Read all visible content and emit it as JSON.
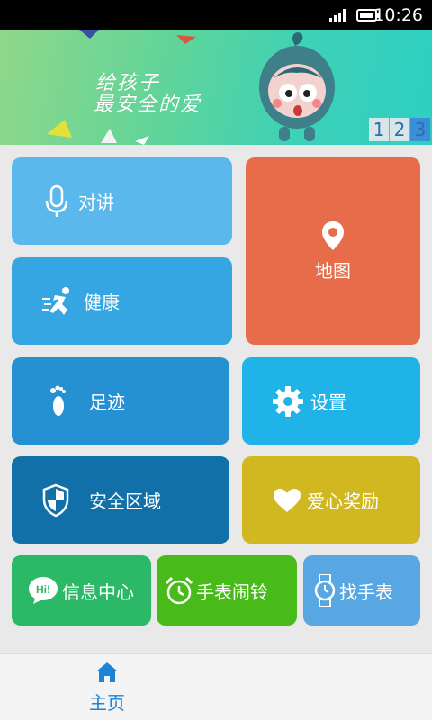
{
  "status_bar": {
    "time": "10:26"
  },
  "banner": {
    "slogan_line1": "给孩子",
    "slogan_line2": "最安全的爱",
    "pages": [
      "1",
      "2",
      "3"
    ],
    "active_page": "3"
  },
  "tiles": {
    "intercom": "对讲",
    "map": "地图",
    "health": "健康",
    "footprint": "足迹",
    "settings": "设置",
    "safe_zone": "安全区域",
    "love_reward": "爱心奖励",
    "message_center": "信息中心",
    "watch_alarm": "手表闹铃",
    "find_watch": "找手表"
  },
  "bottom_nav": {
    "home": "主页"
  },
  "colors": {
    "intercom": "#5bb8ec",
    "map": "#e76c49",
    "health": "#36a6e2",
    "footprint": "#2590d2",
    "settings": "#1fb3e8",
    "safe_zone": "#1270a8",
    "love_reward": "#d1b821",
    "message_center": "#2bb968",
    "watch_alarm": "#48bb1b",
    "find_watch": "#58a6e2"
  }
}
